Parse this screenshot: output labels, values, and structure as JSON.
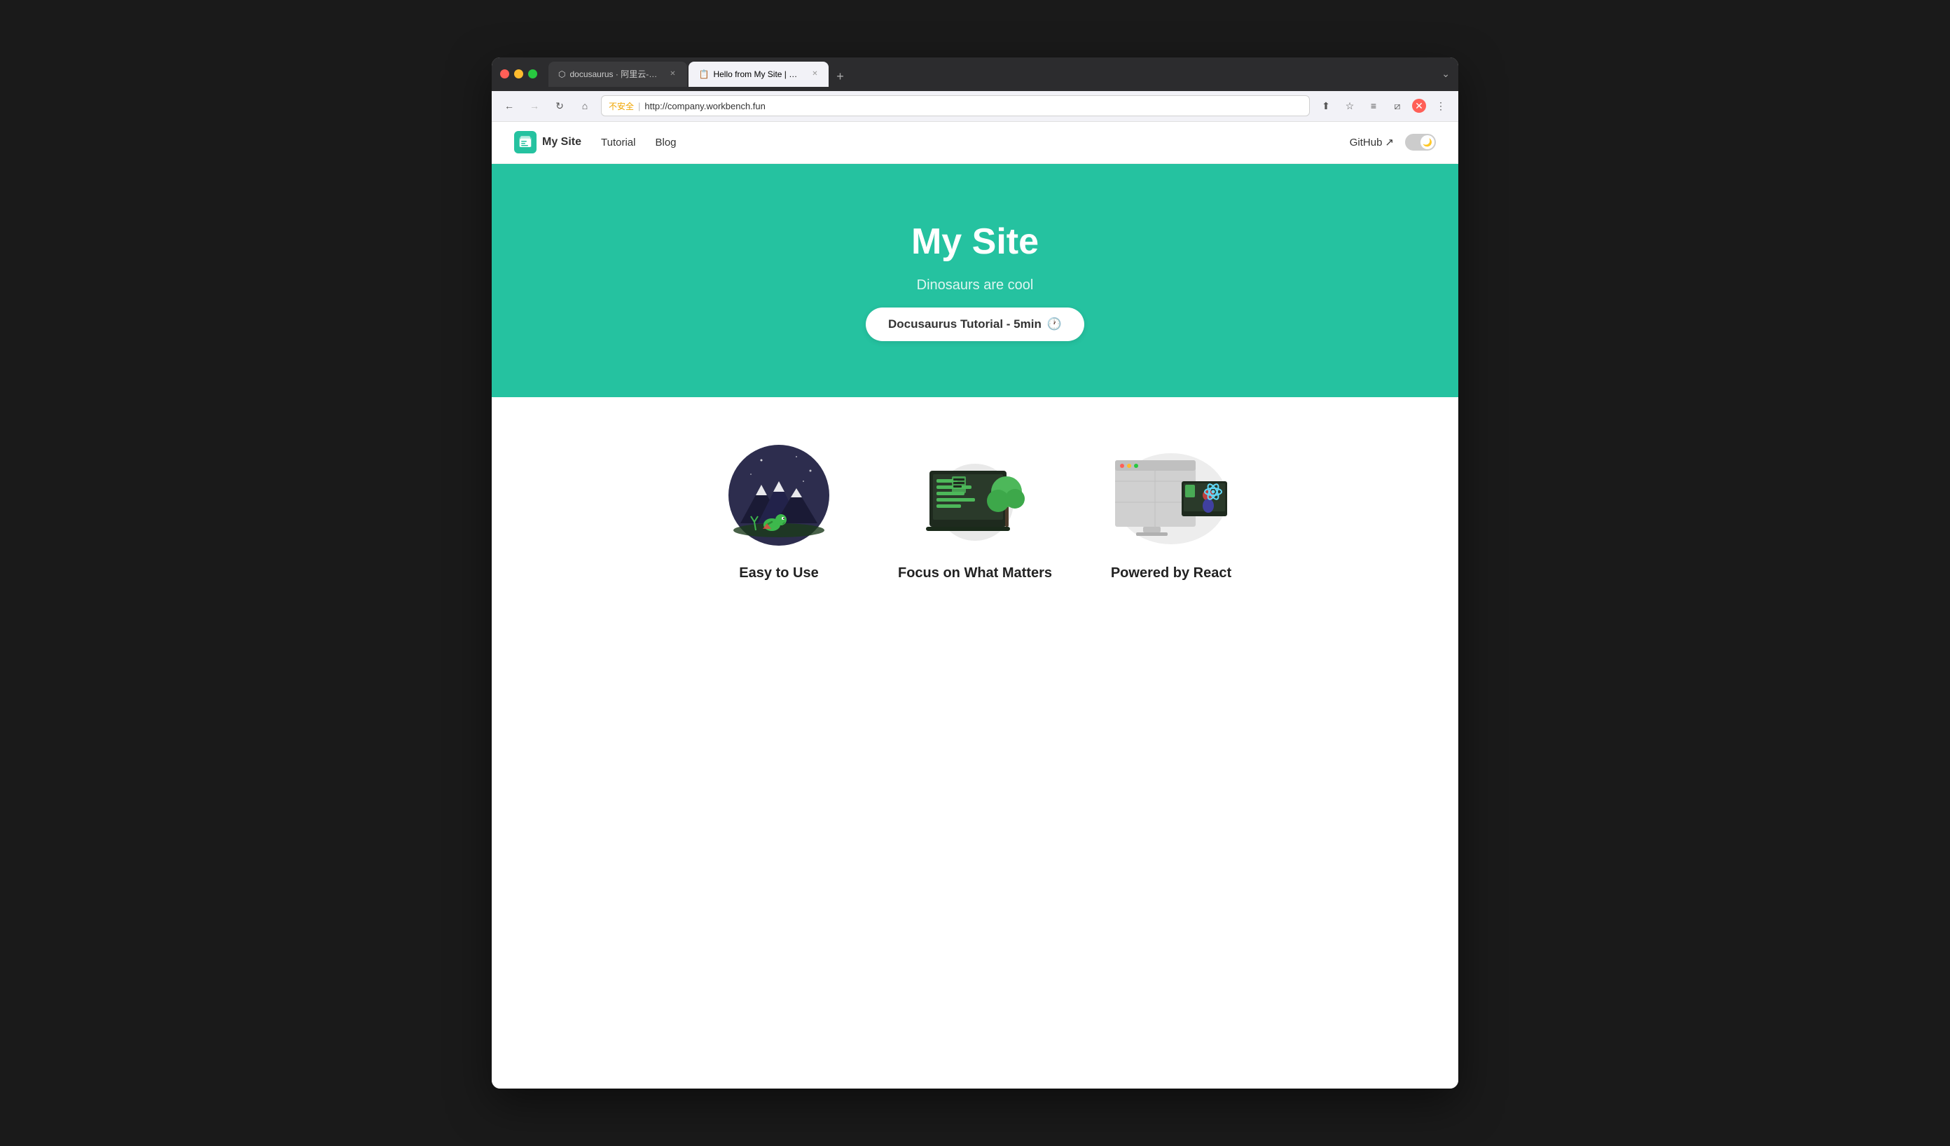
{
  "browser": {
    "tabs": [
      {
        "id": "tab-docusaurus",
        "label": "docusaurus · 阿里云-云开发平...",
        "active": false,
        "icon": "docusaurus-icon"
      },
      {
        "id": "tab-mysite",
        "label": "Hello from My Site | My Site",
        "active": true,
        "icon": "mysite-icon"
      }
    ],
    "new_tab_label": "+",
    "expand_icon": "chevron-down",
    "nav": {
      "back_disabled": false,
      "forward_disabled": true
    },
    "address_bar": {
      "warning": "不安全",
      "separator": "|",
      "url": "http://company.workbench.fun"
    },
    "toolbar_icons": [
      "share",
      "star",
      "reader",
      "extensions",
      "close"
    ]
  },
  "site": {
    "logo_text": "My Site",
    "logo_emoji": "📋",
    "nav_links": [
      {
        "label": "Tutorial"
      },
      {
        "label": "Blog"
      }
    ],
    "github_label": "GitHub",
    "github_icon": "↗",
    "dark_mode_icon": "🌙"
  },
  "hero": {
    "title": "My Site",
    "subtitle": "Dinosaurs are cool",
    "button_label": "Docusaurus Tutorial - 5min",
    "button_icon": "🕐"
  },
  "features": [
    {
      "id": "easy-to-use",
      "title": "Easy to Use",
      "illustration": "mountains-dino"
    },
    {
      "id": "focus-on-matters",
      "title": "Focus on What Matters",
      "illustration": "laptop-dino"
    },
    {
      "id": "powered-by-react",
      "title": "Powered by React",
      "illustration": "monitor-react"
    }
  ],
  "colors": {
    "hero_bg": "#25c2a0",
    "hero_title": "#ffffff",
    "hero_subtitle": "rgba(255,255,255,0.85)",
    "button_bg": "#ffffff",
    "navbar_bg": "#ffffff",
    "logo_bg": "#25c2a0"
  }
}
